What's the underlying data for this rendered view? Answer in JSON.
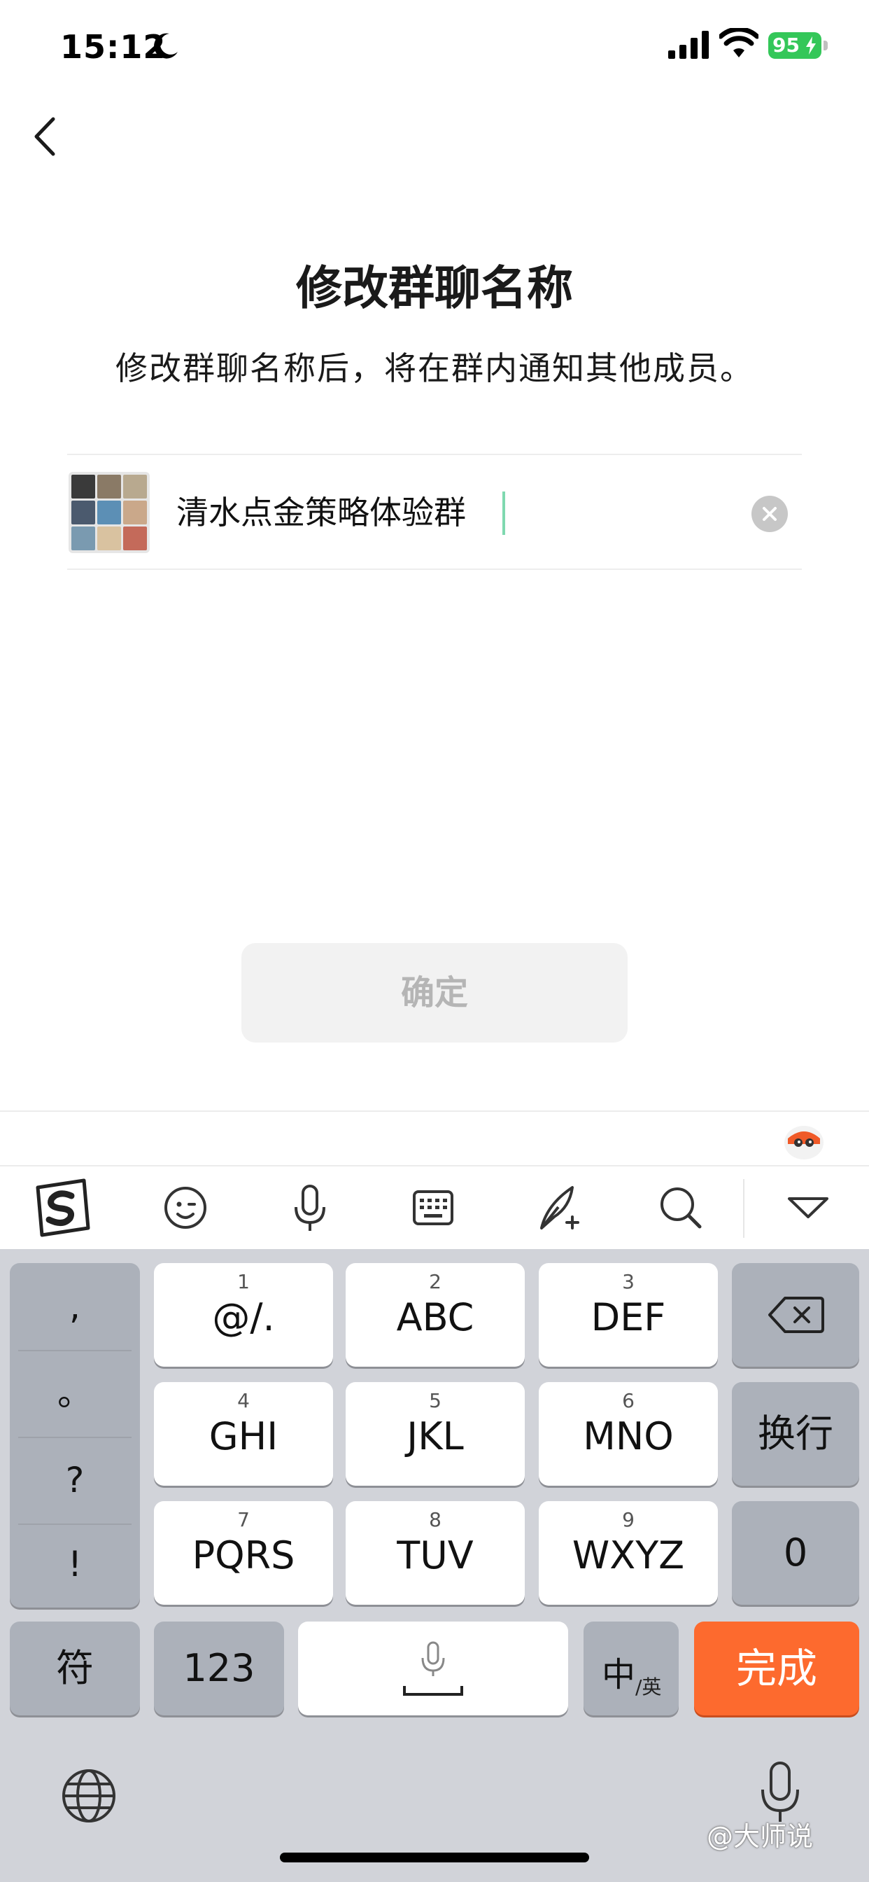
{
  "status_bar": {
    "time": "15:12",
    "battery": "95"
  },
  "header": {
    "title": "修改群聊名称",
    "subtitle": "修改群聊名称后，将在群内通知其他成员。"
  },
  "name_field": {
    "value": "清水点金策略体验群"
  },
  "confirm_label": "确定",
  "keyboard": {
    "punctuation": [
      ",",
      "。",
      "?",
      "!"
    ],
    "keys": [
      {
        "num": "1",
        "label": "@/."
      },
      {
        "num": "2",
        "label": "ABC"
      },
      {
        "num": "3",
        "label": "DEF"
      },
      {
        "num": "4",
        "label": "GHI"
      },
      {
        "num": "5",
        "label": "JKL"
      },
      {
        "num": "6",
        "label": "MNO"
      },
      {
        "num": "7",
        "label": "PQRS"
      },
      {
        "num": "8",
        "label": "TUV"
      },
      {
        "num": "9",
        "label": "WXYZ"
      }
    ],
    "return_label": "换行",
    "zero_label": "0",
    "symbols_label": "符",
    "numbers_label": "123",
    "lang_label": "中",
    "lang_sub_label": "/英",
    "done_label": "完成"
  },
  "toolbar_icons": [
    "sogou-logo-icon",
    "emoji-icon",
    "microphone-icon",
    "keyboard-icon",
    "quill-icon",
    "search-icon",
    "collapse-keyboard-icon"
  ],
  "watermark": "@大师说",
  "colors": {
    "accent_orange": "#fd6a2e",
    "battery_green": "#34c759",
    "caret_green": "#7fd9b0",
    "keyboard_bg": "#d1d3d9"
  }
}
